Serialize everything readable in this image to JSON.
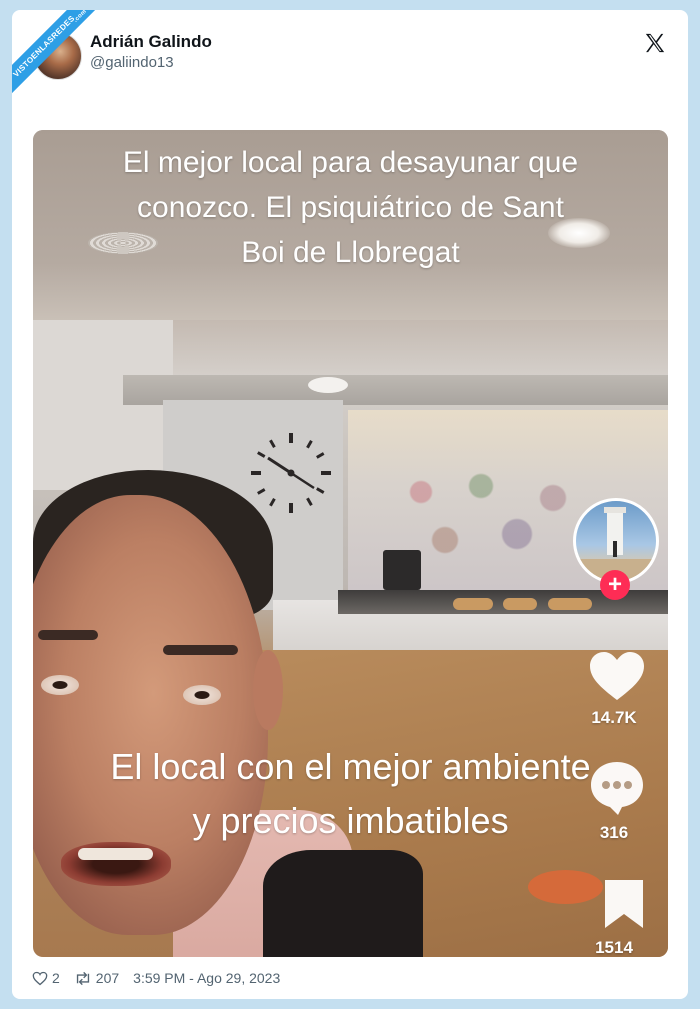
{
  "watermark": {
    "text": "VISTOENLASREDES",
    "sub": ".com"
  },
  "author": {
    "name": "Adrián Galindo",
    "handle": "@galiindo13"
  },
  "platform_icon": "x-logo-icon",
  "video": {
    "top_caption": "El mejor local para desayunar que conozco. El psiquiátrico de Sant Boi de Llobregat",
    "bottom_caption": "El local con el mejor ambiente y precios imbatibles",
    "likes": "14.7K",
    "comments": "316",
    "saves": "1514",
    "follow_symbol": "+",
    "follow_color": "#fe2c55"
  },
  "footer": {
    "likes": "2",
    "retweets": "207",
    "timestamp": "3:59 PM - Ago 29, 2023"
  },
  "colors": {
    "background": "#c4dff0",
    "card": "#ffffff",
    "ribbon": "#2e9fe6",
    "text": "#0f1419",
    "muted": "#536471"
  }
}
